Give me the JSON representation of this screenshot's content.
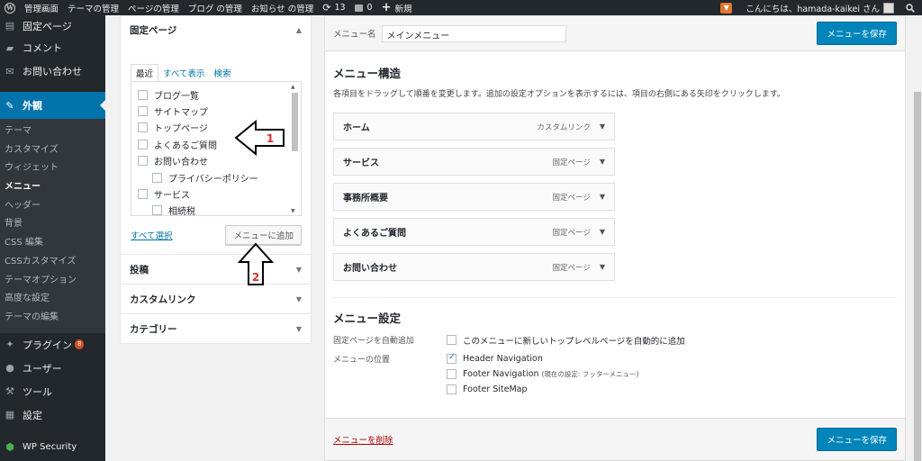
{
  "adminbar": {
    "site_name": "管理画面",
    "items": [
      "テーマの管理",
      "ページの管理",
      "ブログ の管理",
      "お知らせ の管理"
    ],
    "updates_count": "13",
    "comments_count": "0",
    "new_label": "新規",
    "greeting": "こんにちは、hamada-kaikei さん"
  },
  "sidebar": {
    "top": [
      {
        "label": "固定ページ",
        "icon": "pages-icon"
      },
      {
        "label": "コメント",
        "icon": "comments-icon"
      },
      {
        "label": "お問い合わせ",
        "icon": "mail-icon"
      }
    ],
    "active": {
      "label": "外観",
      "icon": "appearance-icon"
    },
    "sub": [
      "テーマ",
      "カスタマイズ",
      "ウィジェット",
      "メニュー",
      "ヘッダー",
      "背景",
      "CSS 編集",
      "CSSカスタマイズ",
      "テーマオプション",
      "高度な設定",
      "テーマの編集"
    ],
    "current_sub": "メニュー",
    "bottom": [
      {
        "label": "プラグイン",
        "icon": "plugins-icon",
        "badge": "8"
      },
      {
        "label": "ユーザー",
        "icon": "users-icon"
      },
      {
        "label": "ツール",
        "icon": "tools-icon"
      },
      {
        "label": "設定",
        "icon": "settings-icon"
      }
    ],
    "security": {
      "label": "WP Security",
      "icon": "shield-icon"
    }
  },
  "left": {
    "pages_title": "固定ページ",
    "tabs": [
      "最近",
      "すべて表示",
      "検索"
    ],
    "pages": [
      {
        "label": "ブログ一覧",
        "child": false
      },
      {
        "label": "サイトマップ",
        "child": false
      },
      {
        "label": "トップページ",
        "child": false
      },
      {
        "label": "よくあるご質問",
        "child": false
      },
      {
        "label": "お問い合わせ",
        "child": false
      },
      {
        "label": "プライバシーポリシー",
        "child": true
      },
      {
        "label": "サービス",
        "child": false
      },
      {
        "label": "相続税",
        "child": true
      }
    ],
    "select_all": "すべて選択",
    "add_button": "メニューに追加",
    "sections": [
      "投稿",
      "カスタムリンク",
      "カテゴリー"
    ]
  },
  "annotations": {
    "one": "1",
    "two": "2"
  },
  "right": {
    "name_label": "メニュー名",
    "name_value": "メインメニュー",
    "save_label": "メニューを保存",
    "structure_title": "メニュー構造",
    "structure_desc": "各項目をドラッグして順番を変更します。追加の設定オプションを表示するには、項目の右側にある矢印をクリックします。",
    "items": [
      {
        "label": "ホーム",
        "type": "カスタムリンク"
      },
      {
        "label": "サービス",
        "type": "固定ページ"
      },
      {
        "label": "事務所概要",
        "type": "固定ページ"
      },
      {
        "label": "よくあるご質問",
        "type": "固定ページ"
      },
      {
        "label": "お問い合わせ",
        "type": "固定ページ"
      }
    ],
    "settings_title": "メニュー設定",
    "auto_add_label": "固定ページを自動追加",
    "auto_add_option": "このメニューに新しいトップレベルページを自動的に追加",
    "location_label": "メニューの位置",
    "locations": [
      {
        "label": "Header Navigation",
        "note": "",
        "checked": true
      },
      {
        "label": "Footer Navigation",
        "note": "(現在の設定: フッターメニュー)",
        "checked": false
      },
      {
        "label": "Footer SiteMap",
        "note": "",
        "checked": false
      }
    ],
    "delete_label": "メニューを削除"
  }
}
